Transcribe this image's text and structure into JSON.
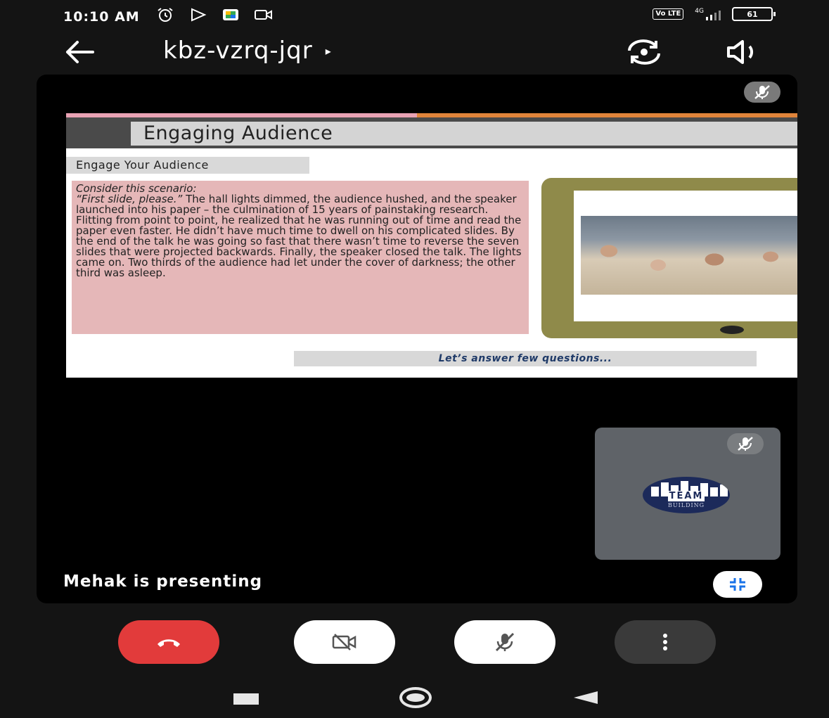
{
  "status_bar": {
    "time": "10:10 AM",
    "network": "4G",
    "volte": "Vo LTE",
    "battery": "61"
  },
  "header": {
    "meeting_code": "kbz-vzrq-jqr",
    "caret": "▸"
  },
  "slide": {
    "title": "Engaging Audience",
    "subheading": "Engage Your Audience",
    "scenario_label": "Consider this scenario:",
    "quote": "“First slide, please.”",
    "body": " The hall lights dimmed, the audience hushed, and the speaker launched into his paper – the culmination of 15 years of painstaking research. Flitting from point to point, he realized that he was running out of time and read the paper even faster. He didn’t have much time to dwell on his complicated slides. By the end of the talk he was going so fast that there wasn’t time to reverse the seven slides that were projected backwards. Finally, the speaker closed the talk. The lights came on. Two thirds of the audience had let under the cover of darkness; the other third was asleep.",
    "footer_prompt": "Let’s answer few questions..."
  },
  "self_tile": {
    "logo_word": "TEAM",
    "logo_sub": "BUILDING"
  },
  "presenting_label": "Mehak is presenting",
  "colors": {
    "end_call": "#e23b3b",
    "stage_bg": "#000000",
    "page_bg": "#141414",
    "text_box": "#e5b7b8",
    "accent_blue": "#1a73e8"
  },
  "icons": {
    "back": "arrow-left-icon",
    "switch_camera": "camera-switch-icon",
    "speaker": "speaker-icon",
    "mic_off": "mic-off-icon",
    "camera_off": "camera-off-icon",
    "end_call": "phone-hangup-icon",
    "more": "more-vertical-icon",
    "minimize": "minimize-icon"
  }
}
